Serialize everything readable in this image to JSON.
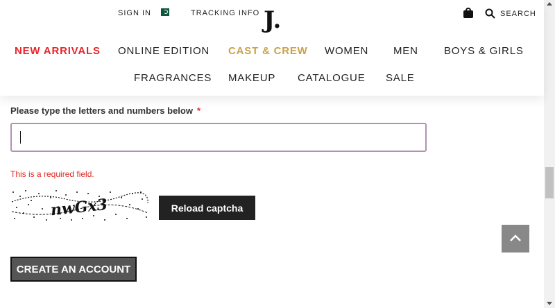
{
  "header": {
    "sign_in": "SIGN IN",
    "tracking": "TRACKING INFO",
    "logo": "J.",
    "search": "SEARCH",
    "country_flag": "pakistan-flag-icon"
  },
  "nav": {
    "row1": [
      "NEW ARRIVALS",
      "ONLINE EDITION",
      "CAST & CREW",
      "WOMEN",
      "MEN",
      "BOYS & GIRLS"
    ],
    "row2": [
      "FRAGRANCES",
      "MAKEUP",
      "CATALOGUE",
      "SALE"
    ]
  },
  "form": {
    "captcha_label": "Please type the letters and numbers below",
    "required_star": "*",
    "captcha_value": "",
    "error": "This is a required field.",
    "captcha_text": "nwGx3",
    "reload_label": "Reload captcha",
    "create_label": "CREATE AN ACCOUNT"
  },
  "colors": {
    "accent_red": "#e8242a",
    "accent_gold": "#c9a24b",
    "input_focus": "#b291b5",
    "button_dark": "#222222"
  }
}
